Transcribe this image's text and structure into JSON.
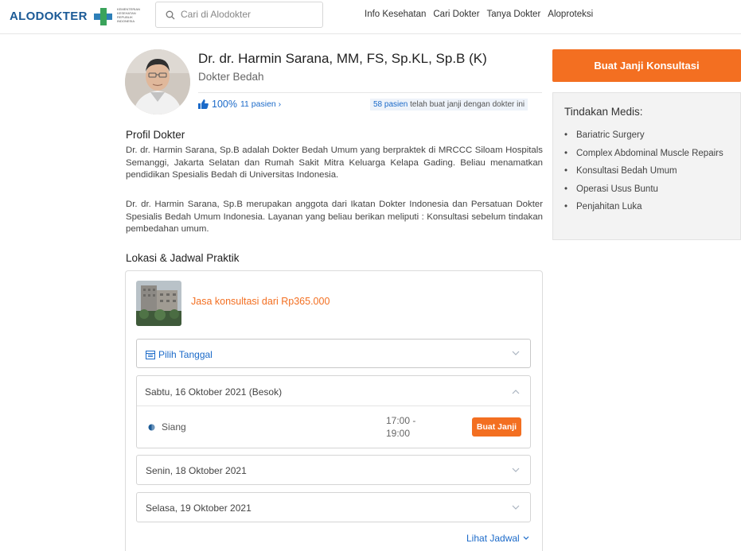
{
  "header": {
    "logo": "ALODOKTER",
    "partner_logo_lines": [
      "KEMENTERIAN",
      "KESEHATAN",
      "REPUBLIK",
      "INDONESIA"
    ],
    "search_placeholder": "Cari di Alodokter",
    "nav": [
      "Info Kesehatan",
      "Cari Dokter",
      "Tanya Dokter",
      "Aloproteksi"
    ]
  },
  "doctor": {
    "name": "Dr. dr. Harmin Sarana, MM, FS, Sp.KL, Sp.B (K)",
    "specialty": "Dokter Bedah",
    "rating_percent": "100%",
    "rating_count": "11 pasien ›",
    "booked_count": "58 pasien",
    "booked_text": " telah buat janji dengan dokter ini"
  },
  "profile": {
    "title": "Profil Dokter",
    "paragraph1": "Dr. dr. Harmin Sarana, Sp.B adalah Dokter Bedah Umum yang berpraktek di MRCCC Siloam Hospitals Semanggi, Jakarta Selatan dan Rumah Sakit Mitra Keluarga Kelapa Gading. Beliau menamatkan pendidikan Spesialis Bedah di Universitas Indonesia.",
    "paragraph2": "Dr. dr. Harmin Sarana, Sp.B merupakan anggota dari Ikatan Dokter Indonesia dan Persatuan Dokter Spesialis Bedah Umum Indonesia. Layanan yang beliau berikan meliputi : Konsultasi sebelum tindakan pembedahan umum."
  },
  "location": {
    "title": "Lokasi & Jadwal Praktik",
    "price_text": "Jasa konsultasi dari Rp365.000",
    "pick_date": "Pilih Tanggal",
    "open_day": "Sabtu, 16 Oktober 2021 (Besok)",
    "slot": {
      "name": "Siang",
      "time_start": "17:00 -",
      "time_end": "19:00",
      "button": "Buat Janji"
    },
    "days": [
      "Senin, 18 Oktober 2021",
      "Selasa, 19 Oktober 2021"
    ],
    "see_schedule": "Lihat Jadwal"
  },
  "sidebar": {
    "cta": "Buat Janji Konsultasi",
    "tindakan_title": "Tindakan Medis:",
    "tindakan": [
      "Bariatric Surgery",
      "Complex Abdominal Muscle Repairs",
      "Konsultasi Bedah Umum",
      "Operasi Usus Buntu",
      "Penjahitan Luka"
    ]
  },
  "colors": {
    "brand": "#1b5a96",
    "accent": "#f36f21",
    "link": "#1b6ac9"
  }
}
